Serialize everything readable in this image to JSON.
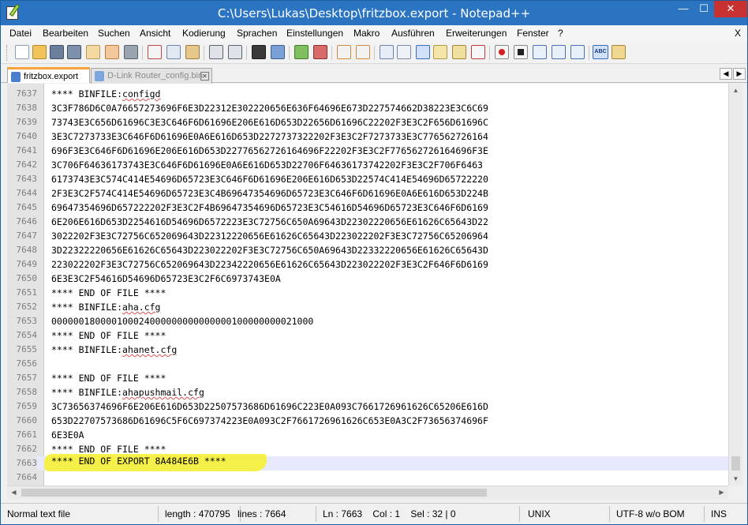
{
  "window": {
    "title": "C:\\Users\\Lukas\\Desktop\\fritzbox.export - Notepad++",
    "minimize": "—",
    "maximize": "☐",
    "close": "✕"
  },
  "menu": {
    "items": [
      "Datei",
      "Bearbeiten",
      "Suchen",
      "Ansicht",
      "Kodierung",
      "Sprachen",
      "Einstellungen",
      "Makro",
      "Ausführen",
      "Erweiterungen",
      "Fenster",
      "?"
    ],
    "close": "X"
  },
  "toolbar": {
    "icons": [
      "new-file-icon",
      "open-file-icon",
      "save-icon",
      "save-all-icon",
      "close-icon",
      "close-all-icon",
      "print-icon",
      "cut-icon",
      "copy-icon",
      "paste-icon",
      "undo-icon",
      "redo-icon",
      "find-icon",
      "replace-icon",
      "zoom-in-icon",
      "zoom-out-icon",
      "sync-vertical-icon",
      "sync-horizontal-icon",
      "word-wrap-icon",
      "all-chars-icon",
      "indent-guide-icon",
      "user-lang-icon",
      "doc-map-icon",
      "function-list-icon",
      "record-macro-icon",
      "stop-macro-icon",
      "play-macro-icon",
      "run-macro-multiple-icon",
      "save-macro-icon",
      "spell-check-icon",
      "spell-check-options-icon"
    ]
  },
  "tabs": [
    {
      "label": "fritzbox.export",
      "active": true
    },
    {
      "label": "D-Link Router_config.bin",
      "active": false
    }
  ],
  "editor": {
    "lines": [
      {
        "num": "7637",
        "text": "**** BINFILE:configd"
      },
      {
        "num": "7638",
        "text": "3C3F786D6C0A76657273696F6E3D22312E302220656E636F64696E673D227574662D38223E3C6C69"
      },
      {
        "num": "7639",
        "text": "73743E3C656D61696C3E3C646F6D61696E206E616D653D22656D61696C22202F3E3C2F656D61696C"
      },
      {
        "num": "7640",
        "text": "3E3C7273733E3C646F6D61696E0A6E616D653D2272737322202F3E3C2F7273733E3C776562726164"
      },
      {
        "num": "7641",
        "text": "696F3E3C646F6D61696E206E616D653D22776562726164696F22202F3E3C2F776562726164696F3E"
      },
      {
        "num": "7642",
        "text": "3C706F64636173743E3C646F6D61696E0A6E616D653D22706F64636173742202F3E3C2F706F6463"
      },
      {
        "num": "7643",
        "text": "6173743E3C574C414E54696D65723E3C646F6D61696E206E616D653D22574C414E54696D65722220"
      },
      {
        "num": "7644",
        "text": "2F3E3C2F574C414E54696D65723E3C4B69647354696D65723E3C646F6D61696E0A6E616D653D224B"
      },
      {
        "num": "7645",
        "text": "69647354696D657222202F3E3C2F4B69647354696D65723E3C54616D54696D65723E3C646F6D6169"
      },
      {
        "num": "7646",
        "text": "6E206E616D653D2254616D54696D6572223E3C72756C650A69643D22302220656E61626C65643D22"
      },
      {
        "num": "7647",
        "text": "3022202F3E3C72756C652069643D22312220656E61626C65643D223022202F3E3C72756C65206964"
      },
      {
        "num": "7648",
        "text": "3D22322220656E61626C65643D223022202F3E3C72756C650A69643D22332220656E61626C65643D"
      },
      {
        "num": "7649",
        "text": "223022202F3E3C72756C652069643D22342220656E61626C65643D223022202F3E3C2F646F6D6169"
      },
      {
        "num": "7650",
        "text": "6E3E3C2F54616D54696D65723E3C2F6C6973743E0A"
      },
      {
        "num": "7651",
        "text": "**** END OF FILE ****"
      },
      {
        "num": "7652",
        "text": "**** BINFILE:aha.cfg"
      },
      {
        "num": "7653",
        "text": "000000180000100024000000000000000100000000021000"
      },
      {
        "num": "7654",
        "text": "**** END OF FILE ****"
      },
      {
        "num": "7655",
        "text": "**** BINFILE:ahanet.cfg"
      },
      {
        "num": "7656",
        "text": ""
      },
      {
        "num": "7657",
        "text": "**** END OF FILE ****"
      },
      {
        "num": "7658",
        "text": "**** BINFILE:ahapushmail.cfg"
      },
      {
        "num": "7659",
        "text": "3C73656374696F6E206E616D653D22507573686D61696C223E0A093C7661726961626C65206E616D"
      },
      {
        "num": "7660",
        "text": "653D22707573686D61696C5F6C697374223E0A093C2F7661726961626C653E0A3C2F73656374696F"
      },
      {
        "num": "7661",
        "text": "6E3E0A"
      },
      {
        "num": "7662",
        "text": "**** END OF FILE ****"
      },
      {
        "num": "7663",
        "text": "**** END OF EXPORT 8A484E6B ****"
      },
      {
        "num": "7664",
        "text": ""
      }
    ],
    "current_line": "7663"
  },
  "statusbar": {
    "filetype": "Normal text file",
    "length": "length : 470795",
    "lines": "lines : 7664",
    "position": "Ln : 7663    Col : 1    Sel : 32 | 0",
    "eol": "UNIX",
    "encoding": "UTF-8 w/o BOM",
    "mode": "INS"
  },
  "colors": {
    "titlebar": "#2b74c2",
    "tab_accent": "#f7a23a",
    "highlight": "#f7f02a",
    "current_line": "#e8e8ff"
  }
}
